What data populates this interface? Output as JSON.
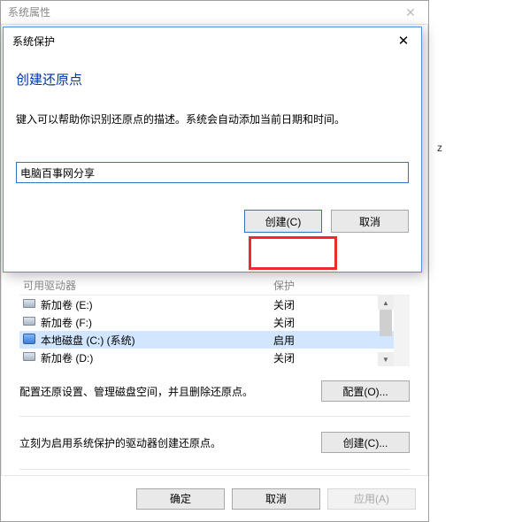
{
  "parent_window": {
    "title": "系统属性"
  },
  "z_letter": "z",
  "modal": {
    "title": "系统保护",
    "heading": "创建还原点",
    "description": "键入可以帮助你识别还原点的描述。系统会自动添加当前日期和时间。",
    "input_value": "电脑百事网分享",
    "create_btn": "创建(C)",
    "cancel_btn": "取消"
  },
  "drive_table": {
    "header_col1": "可用驱动器",
    "header_col2": "保护",
    "rows": [
      {
        "icon": "disk",
        "name": "新加卷 (E:)",
        "status": "关闭",
        "selected": false
      },
      {
        "icon": "disk",
        "name": "新加卷 (F:)",
        "status": "关闭",
        "selected": false
      },
      {
        "icon": "sys",
        "name": "本地磁盘 (C:) (系统)",
        "status": "启用",
        "selected": true
      },
      {
        "icon": "disk",
        "name": "新加卷 (D:)",
        "status": "关闭",
        "selected": false
      }
    ]
  },
  "config_section": {
    "text": "配置还原设置、管理磁盘空间，并且删除还原点。",
    "button": "配置(O)..."
  },
  "create_section": {
    "text": "立刻为启用系统保护的驱动器创建还原点。",
    "button": "创建(C)..."
  },
  "bottom": {
    "ok": "确定",
    "cancel": "取消",
    "apply": "应用(A)"
  }
}
